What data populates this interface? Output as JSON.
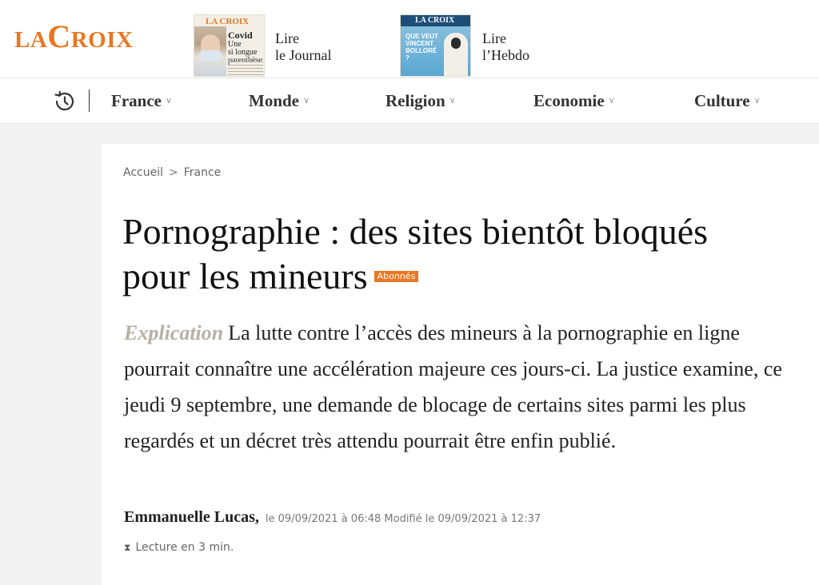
{
  "header": {
    "logo_small_1": "LA",
    "logo_big_1": "C",
    "logo_small_2": "ROIX",
    "brand_color": "#e87722",
    "journal": {
      "cover_masthead": "LA CROIX",
      "cover_headline_1": "Covid",
      "cover_headline_2": "Une",
      "cover_headline_3": "si longue",
      "cover_headline_4": "parenthèse",
      "label_line1": "Lire",
      "label_line2": "le Journal"
    },
    "hebdo": {
      "cover_masthead": "LA CROIX",
      "cover_question": "QUE VEUT VINCENT BOLLORÉ ?",
      "label_line1": "Lire",
      "label_line2": "l’Hebdo"
    }
  },
  "nav": {
    "history_icon": "history-clock-icon",
    "items": [
      {
        "label": "France",
        "chevron": "∨"
      },
      {
        "label": "Monde",
        "chevron": "∨"
      },
      {
        "label": "Religion",
        "chevron": "∨"
      },
      {
        "label": "Economie",
        "chevron": "∨"
      },
      {
        "label": "Culture",
        "chevron": "∨"
      }
    ]
  },
  "breadcrumb": {
    "home": "Accueil",
    "separator": ">",
    "section": "France"
  },
  "article": {
    "title": "Pornographie : des sites bientôt bloqués pour les mineurs",
    "badge": "Abonnés",
    "badge_color": "#e87722",
    "kicker": "Explication",
    "lead": "La lutte contre l’accès des mineurs à la pornographie en ligne pourrait connaître une accélération majeure ces jours-ci. La justice examine, ce jeudi 9 septembre, une demande de blocage de certains sites parmi les plus regardés et un décret très attendu pourrait être enfin publié.",
    "author": "Emmanuelle Lucas",
    "author_comma": ",",
    "dates": "le 09/09/2021 à 06:48 Modifié le 09/09/2021 à 12:37",
    "reading_icon": "hourglass-icon",
    "reading_time": "Lecture en 3 min."
  }
}
